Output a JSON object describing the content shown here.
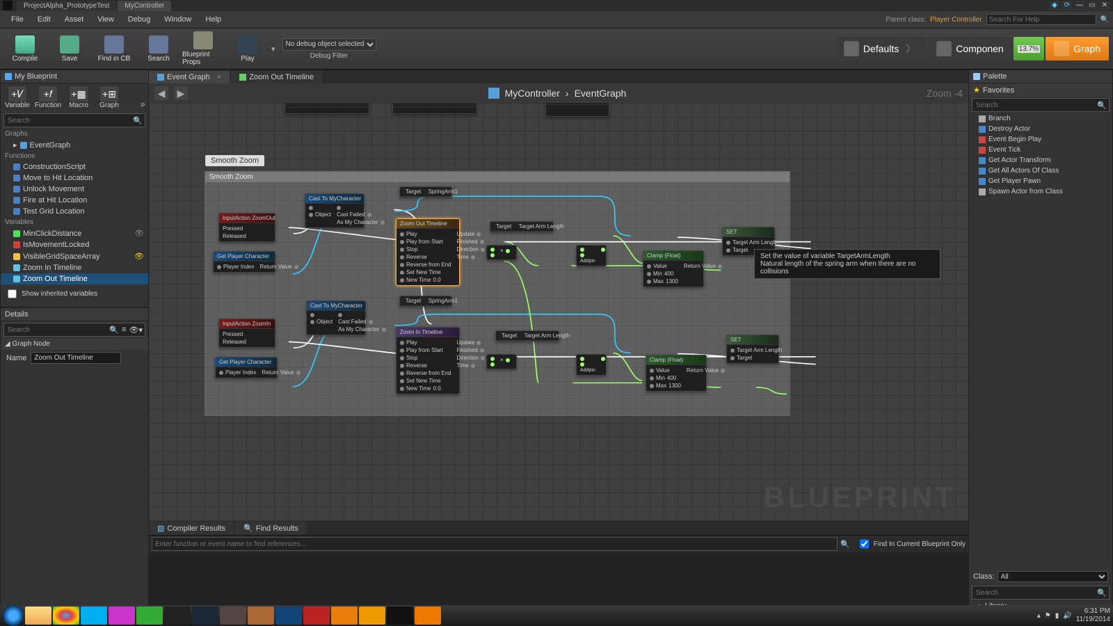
{
  "title_tabs": [
    "ProjectAlpha_PrototypeTest",
    "MyController"
  ],
  "menus": [
    "File",
    "Edit",
    "Asset",
    "View",
    "Debug",
    "Window",
    "Help"
  ],
  "parent_class_label": "Parent class:",
  "parent_class": "Player Controller",
  "search_help_ph": "Search For Help",
  "toolbar": {
    "compile": "Compile",
    "save": "Save",
    "find": "Find in CB",
    "search": "Search",
    "props": "Blueprint Props",
    "play": "Play",
    "dbg_sel": "No debug object selected",
    "dbg_label": "Debug Filter"
  },
  "modes": {
    "defaults": "Defaults",
    "components": "Componen",
    "progress": "13.7%",
    "graph": "Graph"
  },
  "mybp": {
    "title": "My Blueprint",
    "btns": [
      "Variable",
      "Function",
      "Macro",
      "Graph"
    ],
    "search_ph": "Search",
    "cat_graphs": "Graphs",
    "graphs": [
      "EventGraph"
    ],
    "cat_funcs": "Functions",
    "funcs": [
      "ConstructionScript",
      "Move to Hit Location",
      "Unlock Movement",
      "Fire at Hit Location",
      "Test Grid Location"
    ],
    "cat_vars": "Variables",
    "vars": [
      {
        "name": "MinClickDistance",
        "kind": "f"
      },
      {
        "name": "IsMovementLocked",
        "kind": "b"
      },
      {
        "name": "VisibleGridSpaceArray",
        "kind": "a"
      }
    ],
    "timelines": [
      "Zoom In Timeline",
      "Zoom Out Timeline"
    ],
    "show_inherited": "Show inherited variables"
  },
  "details": {
    "title": "Details",
    "search_ph": "Search",
    "section": "Graph Node",
    "name_label": "Name",
    "name_value": "Zoom Out Timeline"
  },
  "center": {
    "tabs": [
      "Event Graph",
      "Zoom Out Timeline"
    ],
    "crumb1": "MyController",
    "crumb2": "EventGraph",
    "zoom": "Zoom -4",
    "comment_title": "Smooth Zoom",
    "comment_head": "Smooth Zoom",
    "watermark": "BLUEPRINT"
  },
  "nodes": {
    "ia_out": "InputAction ZoomOut",
    "ia_in": "InputAction ZoomIn",
    "pressed": "Pressed",
    "released": "Released",
    "getplayer": "Get Player Character",
    "player_index": "Player Index",
    "return_value": "Return Value",
    "cast": "Cast To MyCharacter",
    "object": "Object",
    "cast_failed": "Cast Failed",
    "as_my": "As My Character",
    "tl_out": "Zoom Out Timeline",
    "tl_in": "Zoom In Timeline",
    "tl_play": "Play",
    "tl_playfromstart": "Play from Start",
    "tl_stop": "Stop",
    "tl_reverse": "Reverse",
    "tl_reversefromend": "Reverse from End",
    "tl_setnewtime": "Set New Time",
    "tl_newtime": "New Time",
    "tl_newtime_v": "0.0",
    "tl_update": "Update",
    "tl_finished": "Finished",
    "tl_direction": "Direction",
    "tl_track": "Time",
    "target": "Target",
    "spring": "SpringArm1",
    "arm": "Target Arm Length",
    "clamp": "Clamp (Float)",
    "value": "Value",
    "min": "Min",
    "max": "Max",
    "min_v": "400",
    "max_v": "1300",
    "add": "Addpin",
    "set": "SET",
    "tooltip1": "Set the value of variable TargetArmLength",
    "tooltip2": "Natural length of the spring arm when there are no collisions"
  },
  "bottom": {
    "compiler": "Compiler Results",
    "find": "Find Results",
    "find_ph": "Enter function or event name to find references...",
    "find_chk": "Find In Current Blueprint Only"
  },
  "palette": {
    "title": "Palette",
    "fav": "Favorites",
    "search_ph": "Search",
    "favs": [
      "Branch",
      "Destroy Actor",
      "Event Begin Play",
      "Event Tick",
      "Get Actor Transform",
      "Get All Actors Of Class",
      "Get Player Pawn",
      "Spawn Actor from Class"
    ],
    "class_label": "Class:",
    "class_val": "All",
    "lib": "Library"
  },
  "tray": {
    "time": "6:31 PM",
    "date": "11/19/2014"
  }
}
